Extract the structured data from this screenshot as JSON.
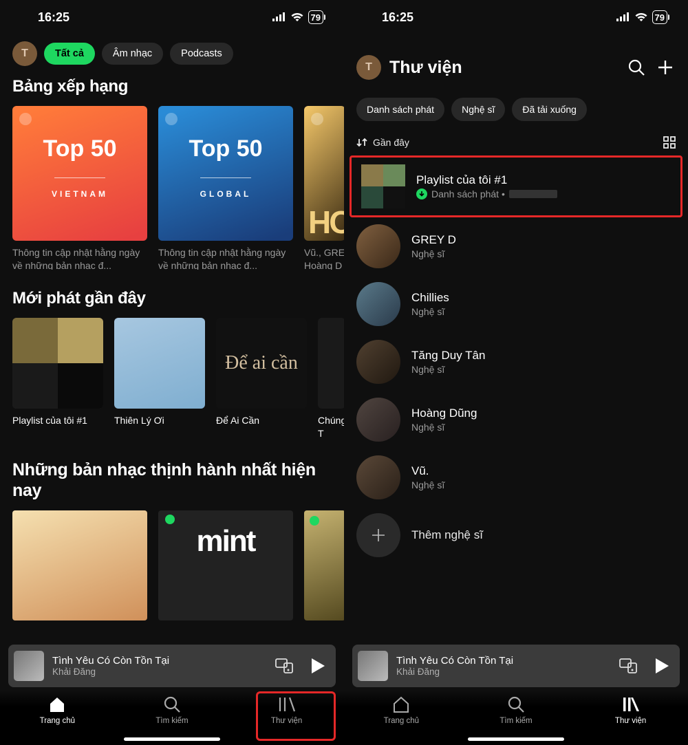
{
  "status": {
    "time": "16:25",
    "battery": "79"
  },
  "left": {
    "avatar_letter": "T",
    "chips": [
      {
        "label": "Tất cả",
        "active": true
      },
      {
        "label": "Âm nhạc",
        "active": false
      },
      {
        "label": "Podcasts",
        "active": false
      }
    ],
    "section_charts": "Bảng xếp hạng",
    "chart_cards": [
      {
        "big": "Top 50",
        "region": "VIETNAM",
        "caption": "Thông tin cập nhật hằng ngày về những bản nhạc đ..."
      },
      {
        "big": "Top 50",
        "region": "GLOBAL",
        "caption": "Thông tin cập nhật hằng ngày về những bản nhạc đ..."
      },
      {
        "big": "HO",
        "region": "",
        "caption": "Vũ., GRE\nHoàng D"
      }
    ],
    "section_recent": "Mới phát gần đây",
    "recent": [
      {
        "title": "Playlist của tôi #1"
      },
      {
        "title": "Thiên Lý Ơi"
      },
      {
        "title": "Để Ai Cần",
        "art_text": "Để ai cần"
      },
      {
        "title": "Chúng T\nHạnh Ph"
      }
    ],
    "section_trending": "Những bản nhạc thịnh hành nhất hiện nay",
    "mint_label": "mint",
    "nowplaying": {
      "title": "Tình Yêu Có Còn Tồn Tại",
      "artist": "Khải Đăng"
    },
    "tabs": [
      {
        "label": "Trang chủ",
        "active": true
      },
      {
        "label": "Tìm kiếm",
        "active": false
      },
      {
        "label": "Thư viện",
        "active": false
      }
    ]
  },
  "right": {
    "avatar_letter": "T",
    "title": "Thư viện",
    "pills": [
      "Danh sách phát",
      "Nghệ sĩ",
      "Đã tải xuống"
    ],
    "sort_label": "Gần đây",
    "items": [
      {
        "title": "Playlist của tôi #1",
        "sub": "Danh sách phát •",
        "downloaded": true,
        "type": "playlist",
        "highlight": true
      },
      {
        "title": "GREY D",
        "sub": "Nghệ sĩ",
        "type": "artist"
      },
      {
        "title": "Chillies",
        "sub": "Nghệ sĩ",
        "type": "artist"
      },
      {
        "title": "Tăng Duy Tân",
        "sub": "Nghệ sĩ",
        "type": "artist"
      },
      {
        "title": "Hoàng Dũng",
        "sub": "Nghệ sĩ",
        "type": "artist"
      },
      {
        "title": "Vũ.",
        "sub": "Nghệ sĩ",
        "type": "artist"
      }
    ],
    "add_artist": "Thêm nghệ sĩ",
    "nowplaying": {
      "title": "Tình Yêu Có Còn Tồn Tại",
      "artist": "Khải Đăng"
    },
    "tabs": [
      {
        "label": "Trang chủ",
        "active": false
      },
      {
        "label": "Tìm kiếm",
        "active": false
      },
      {
        "label": "Thư viện",
        "active": true
      }
    ]
  }
}
